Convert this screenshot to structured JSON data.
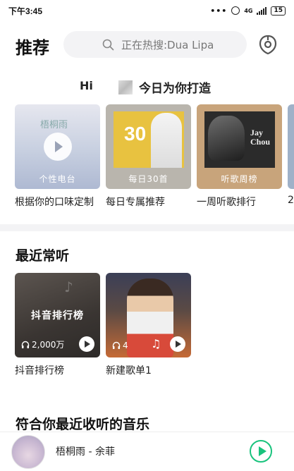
{
  "status_bar": {
    "time": "下午3:45",
    "dots": "•••",
    "network": "4G",
    "battery": "15"
  },
  "header": {
    "title": "推荐",
    "search_placeholder": "正在热搜:Dua Lipa"
  },
  "greeting": {
    "hi": "Hi",
    "subtitle": "今日为你打造"
  },
  "recommend_cards": [
    {
      "tag": "个性电台",
      "label": "根据你的口味定制",
      "cover_text": "梧桐雨"
    },
    {
      "tag": "每日30首",
      "label": "每日专属推荐",
      "cover_text": "30"
    },
    {
      "tag": "听歌周榜",
      "label": "一周听歌排行",
      "cover_text": "Jay Chou"
    },
    {
      "tag": "",
      "label": "2"
    }
  ],
  "recent": {
    "title": "最近常听",
    "items": [
      {
        "cover_title": "抖音排行榜",
        "play_count": "2,000万",
        "label": "抖音排行榜"
      },
      {
        "cover_title": "",
        "play_count": "4",
        "label": "新建歌单1"
      }
    ]
  },
  "suggest": {
    "title": "符合你最近收听的音乐"
  },
  "player": {
    "now_playing": "梧桐雨 - 余菲"
  },
  "colors": {
    "accent_green": "#19c37d",
    "divider": "#f3f3f5"
  }
}
